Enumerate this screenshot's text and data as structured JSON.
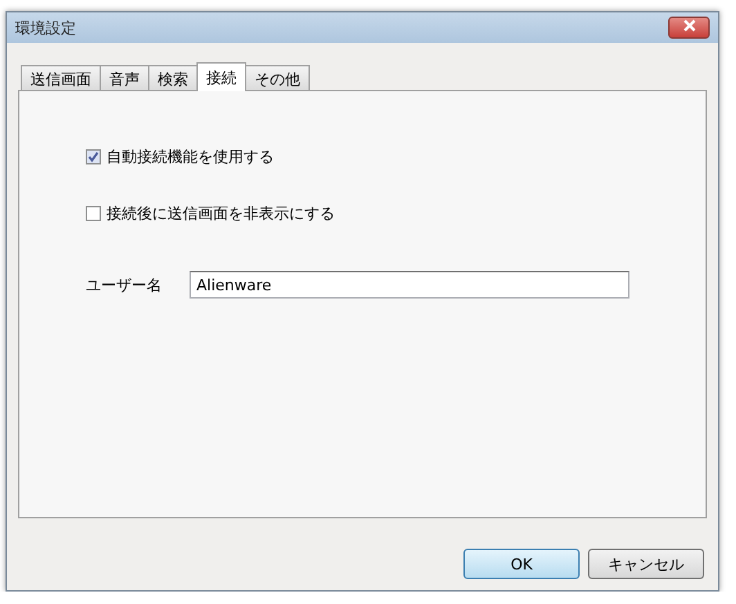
{
  "window": {
    "title": "環境設定"
  },
  "tabs": [
    {
      "label": "送信画面",
      "selected": false
    },
    {
      "label": "音声",
      "selected": false
    },
    {
      "label": "検索",
      "selected": false
    },
    {
      "label": "接続",
      "selected": true
    },
    {
      "label": "その他",
      "selected": false
    }
  ],
  "options": [
    {
      "label": "自動接続機能を使用する",
      "checked": true
    },
    {
      "label": "接続後に送信画面を非表示にする",
      "checked": false
    }
  ],
  "username": {
    "label": "ユーザー名",
    "value": "Alienware"
  },
  "buttons": [
    {
      "label": "OK",
      "kind": "default"
    },
    {
      "label": "キャンセル",
      "kind": "normal"
    }
  ]
}
